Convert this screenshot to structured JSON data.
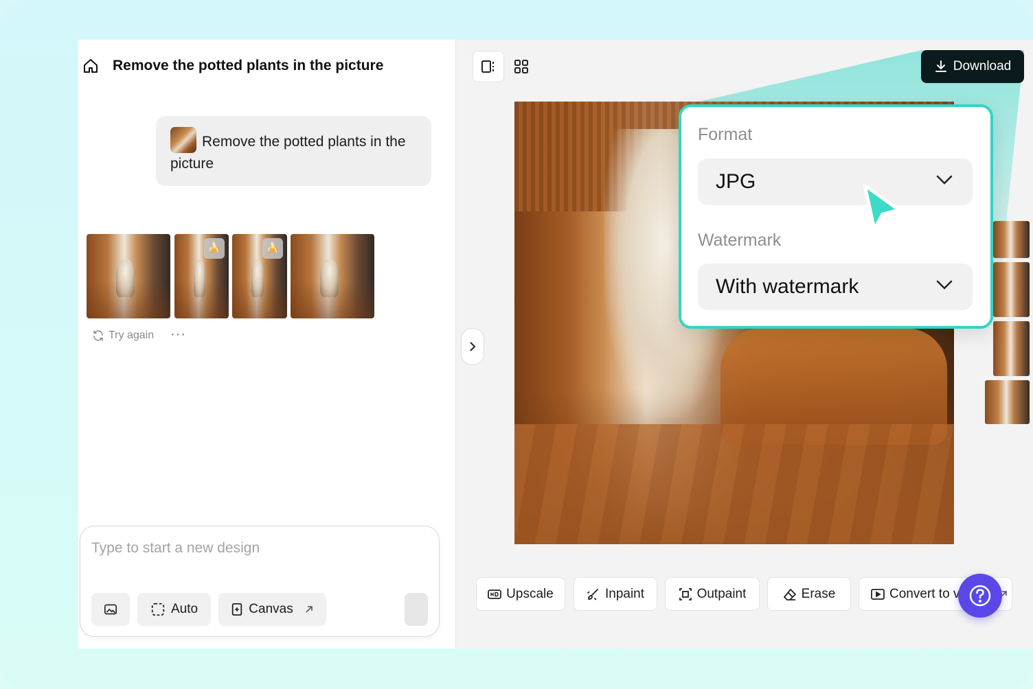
{
  "header": {
    "title": "Remove the potted plants in the picture"
  },
  "chat": {
    "prompt": "Remove the potted plants in the picture",
    "results_count": 4,
    "try_again_label": "Try again",
    "more_label": "···"
  },
  "composer": {
    "placeholder": "Type to start a new design",
    "auto_label": "Auto",
    "canvas_label": "Canvas"
  },
  "toolbar": {
    "download_label": "Download"
  },
  "download_popup": {
    "format_label": "Format",
    "format_value": "JPG",
    "watermark_label": "Watermark",
    "watermark_value": "With watermark"
  },
  "edit_tools": {
    "upscale": "Upscale",
    "inpaint": "Inpaint",
    "outpaint": "Outpaint",
    "erase": "Erase",
    "convert": "Convert to v"
  },
  "colors": {
    "accent": "#34d4c6",
    "download_bg": "#0b1a1c",
    "help_bg": "#5b47e8",
    "cursor": "#3ddac8"
  },
  "icons": [
    "home-icon",
    "image-upload-icon",
    "auto-select-icon",
    "canvas-icon",
    "external-arrow-icon",
    "chevron-right-icon",
    "single-view-icon",
    "grid-view-icon",
    "download-icon",
    "chevron-down-icon",
    "hd-icon",
    "inpaint-brush-icon",
    "outpaint-icon",
    "eraser-icon",
    "video-icon",
    "help-icon",
    "refresh-icon",
    "cursor-icon"
  ]
}
